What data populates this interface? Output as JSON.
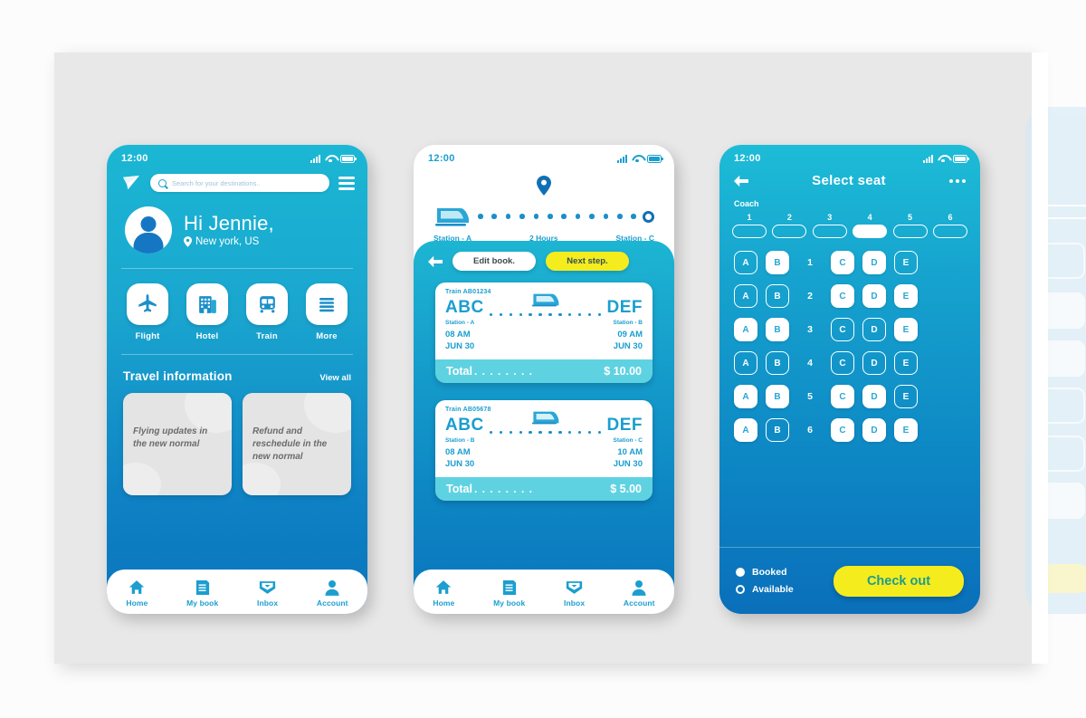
{
  "screen1": {
    "statusbar": {
      "time": "12:00",
      "icons": [
        "signal-icon",
        "wifi-icon",
        "battery-icon"
      ]
    },
    "search": {
      "placeholder": "Search for your destinations..",
      "icon": "search-icon"
    },
    "menu_icon": "hamburger-menu-icon",
    "logo_icon": "paper-plane-icon",
    "greeting": {
      "name": "Hi Jennie,",
      "location": "New york, US",
      "pin_icon": "location-pin-icon",
      "avatar": "user-avatar"
    },
    "quick_actions": [
      {
        "label": "Flight",
        "icon": "airplane-icon"
      },
      {
        "label": "Hotel",
        "icon": "hotel-building-icon"
      },
      {
        "label": "Train",
        "icon": "train-bus-icon"
      },
      {
        "label": "More",
        "icon": "list-lines-icon"
      }
    ],
    "travel_info": {
      "title": "Travel information",
      "view_all": "View all",
      "cards": [
        "Flying updates in the new normal",
        "Refund and reschedule in the new normal"
      ]
    },
    "bottom_nav": [
      {
        "label": "Home",
        "icon": "home-icon"
      },
      {
        "label": "My book",
        "icon": "document-icon"
      },
      {
        "label": "Inbox",
        "icon": "envelope-icon"
      },
      {
        "label": "Account",
        "icon": "person-icon"
      }
    ]
  },
  "screen2": {
    "statusbar": {
      "time": "12:00"
    },
    "route": {
      "origin": "Station - A",
      "duration": "2 Hours",
      "destination": "Station - C",
      "train_icon": "train-front-icon",
      "pin_icon": "location-pin-icon"
    },
    "actions": {
      "back_icon": "back-arrow-icon",
      "edit": "Edit book.",
      "next": "Next step."
    },
    "tickets": [
      {
        "train_no": "Train AB01234",
        "from_code": "ABC",
        "to_code": "DEF",
        "from_station": "Station - A",
        "to_station": "Station - B",
        "depart_time": "08 AM",
        "arrive_time": "09 AM",
        "depart_date": "JUN 30",
        "arrive_date": "JUN 30",
        "total_label": "Total",
        "total_dots": ". . . . . . . .",
        "total_value": "$ 10.00"
      },
      {
        "train_no": "Train AB05678",
        "from_code": "ABC",
        "to_code": "DEF",
        "from_station": "Station - B",
        "to_station": "Station - C",
        "depart_time": "08 AM",
        "arrive_time": "10 AM",
        "depart_date": "JUN 30",
        "arrive_date": "JUN 30",
        "total_label": "Total",
        "total_dots": ". . . . . . . .",
        "total_value": "$ 5.00"
      }
    ],
    "bottom_nav": [
      {
        "label": "Home",
        "icon": "home-icon"
      },
      {
        "label": "My book",
        "icon": "document-icon"
      },
      {
        "label": "Inbox",
        "icon": "envelope-icon"
      },
      {
        "label": "Account",
        "icon": "person-icon"
      }
    ]
  },
  "screen3": {
    "statusbar": {
      "time": "12:00"
    },
    "header": {
      "back_icon": "back-arrow-icon",
      "title": "Select seat",
      "more_icon": "more-dots-icon"
    },
    "coach": {
      "label": "Coach",
      "numbers": [
        "1",
        "2",
        "3",
        "4",
        "5",
        "6"
      ],
      "selected": "4"
    },
    "seat_rows": [
      {
        "row": "1",
        "left": [
          {
            "id": "A",
            "booked": false
          },
          {
            "id": "B",
            "booked": true
          }
        ],
        "right": [
          {
            "id": "C",
            "booked": true
          },
          {
            "id": "D",
            "booked": true
          },
          {
            "id": "E",
            "booked": false
          }
        ]
      },
      {
        "row": "2",
        "left": [
          {
            "id": "A",
            "booked": false
          },
          {
            "id": "B",
            "booked": false
          }
        ],
        "right": [
          {
            "id": "C",
            "booked": true
          },
          {
            "id": "D",
            "booked": true
          },
          {
            "id": "E",
            "booked": true
          }
        ]
      },
      {
        "row": "3",
        "left": [
          {
            "id": "A",
            "booked": true
          },
          {
            "id": "B",
            "booked": true
          }
        ],
        "right": [
          {
            "id": "C",
            "booked": false
          },
          {
            "id": "D",
            "booked": false
          },
          {
            "id": "E",
            "booked": true
          }
        ]
      },
      {
        "row": "4",
        "left": [
          {
            "id": "A",
            "booked": false
          },
          {
            "id": "B",
            "booked": false
          }
        ],
        "right": [
          {
            "id": "C",
            "booked": false
          },
          {
            "id": "D",
            "booked": false
          },
          {
            "id": "E",
            "booked": false
          }
        ]
      },
      {
        "row": "5",
        "left": [
          {
            "id": "A",
            "booked": true
          },
          {
            "id": "B",
            "booked": true
          }
        ],
        "right": [
          {
            "id": "C",
            "booked": true
          },
          {
            "id": "D",
            "booked": true
          },
          {
            "id": "E",
            "booked": false
          }
        ]
      },
      {
        "row": "6",
        "left": [
          {
            "id": "A",
            "booked": true
          },
          {
            "id": "B",
            "booked": false
          }
        ],
        "right": [
          {
            "id": "C",
            "booked": true
          },
          {
            "id": "D",
            "booked": true
          },
          {
            "id": "E",
            "booked": true
          }
        ]
      }
    ],
    "legend": [
      {
        "label": "Booked",
        "state": "filled"
      },
      {
        "label": "Available",
        "state": "outline"
      }
    ],
    "checkout": "Check out"
  },
  "colors": {
    "brand_cyan": "#1db5d2",
    "brand_blue": "#0a74bd",
    "accent_yellow": "#f5ec1e",
    "checkout_text": "#1e9c8e",
    "teal_total": "#5fd2e2",
    "canvas": "#e8e8e8",
    "card_grey": "#e4e4e4"
  }
}
